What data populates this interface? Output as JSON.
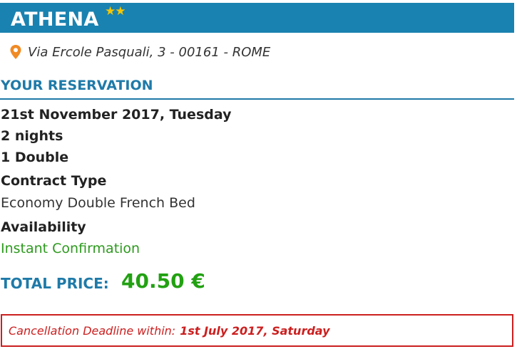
{
  "hotel": {
    "name": "ATHENA",
    "stars_glyph": "★★",
    "address": "Via Ercole Pasquali, 3 - 00161 - ROME"
  },
  "reservation": {
    "title": "YOUR RESERVATION",
    "date": "21st November 2017, Tuesday",
    "nights": "2 nights",
    "rooms": "1 Double",
    "contract_label": "Contract Type",
    "contract_value": "Economy Double French Bed",
    "availability_label": "Availability",
    "availability_value": "Instant Confirmation"
  },
  "price": {
    "label": "TOTAL PRICE:",
    "value": "40.50 €"
  },
  "cancellation": {
    "label": "Cancellation Deadline within:",
    "date": "1st July 2017, Saturday"
  },
  "colors": {
    "header_bg": "#1a82b0",
    "accent_blue": "#1f7aa8",
    "price_green": "#22a112",
    "availability_green": "#2d9a1e",
    "cancel_red": "#cc1f1f",
    "star_gold": "#f7c600",
    "pin_orange": "#f08a24"
  },
  "icons": {
    "stars": "star-icon",
    "location": "map-pin-icon"
  }
}
